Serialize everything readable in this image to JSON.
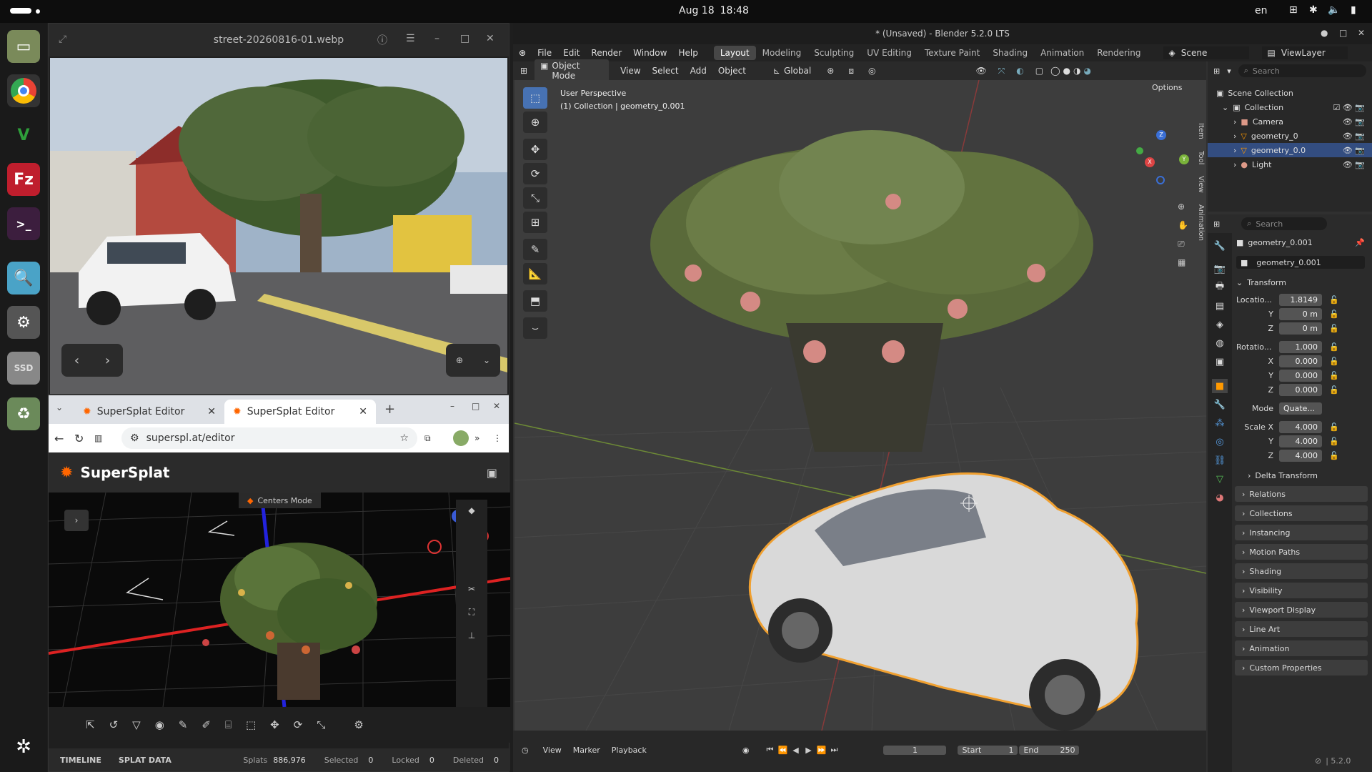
{
  "topbar": {
    "date": "Aug 18",
    "time": "18:48",
    "lang": "en"
  },
  "dock": {
    "ssd_label": "SSD"
  },
  "viewer": {
    "title": "street-20260816-01.webp"
  },
  "chrome": {
    "tabs": [
      {
        "label": "SuperSplat Editor"
      },
      {
        "label": "SuperSplat Editor"
      }
    ],
    "url": "superspl.at/editor"
  },
  "supersplat": {
    "title": "SuperSplat",
    "mode_badge": "Centers Mode",
    "status": {
      "tab1": "TIMELINE",
      "tab2": "SPLAT DATA",
      "splats_label": "Splats",
      "splats": "886,976",
      "selected_label": "Selected",
      "selected": "0",
      "locked_label": "Locked",
      "locked": "0",
      "deleted_label": "Deleted",
      "deleted": "0"
    }
  },
  "blender": {
    "title": "* (Unsaved) - Blender 5.2.0 LTS",
    "menus": [
      "File",
      "Edit",
      "Render",
      "Window",
      "Help"
    ],
    "workspaces": [
      "Layout",
      "Modeling",
      "Sculpting",
      "UV Editing",
      "Texture Paint",
      "Shading",
      "Animation",
      "Rendering"
    ],
    "scene": "Scene",
    "viewlayer": "ViewLayer",
    "header": {
      "mode": "Object Mode",
      "view": "View",
      "select": "Select",
      "add": "Add",
      "object": "Object",
      "orient": "Global",
      "options": "Options"
    },
    "overlay": {
      "line1": "User Perspective",
      "line2": "(1) Collection | geometry_0.001"
    },
    "side_tabs": [
      "Item",
      "Tool",
      "View",
      "Animation"
    ],
    "outliner": {
      "search": "Search",
      "scene_collection": "Scene Collection",
      "collection": "Collection",
      "items": [
        "Camera",
        "geometry_0",
        "geometry_0.0",
        "Light"
      ]
    },
    "props": {
      "search": "Search",
      "object_name": "geometry_0.001",
      "data_name": "geometry_0.001",
      "transform": "Transform",
      "loc_label": "Locatio...",
      "loc_x": "1.8149",
      "loc_y": "0 m",
      "loc_z": "0 m",
      "rot_label": "Rotatio...",
      "rot_w": "1.000",
      "rot_x": "0.000",
      "rot_y": "0.000",
      "rot_z": "0.000",
      "mode_label": "Mode",
      "mode": "Quate...",
      "scale_label": "Scale X",
      "scale_x": "4.000",
      "scale_y": "4.000",
      "scale_z": "4.000",
      "delta": "Delta Transform",
      "panels": [
        "Relations",
        "Collections",
        "Instancing",
        "Motion Paths",
        "Shading",
        "Visibility",
        "Viewport Display",
        "Line Art",
        "Animation",
        "Custom Properties"
      ]
    },
    "timeline": {
      "view": "View",
      "marker": "Marker",
      "playback": "Playback",
      "frame": "1",
      "start_label": "Start",
      "start": "1",
      "end_label": "End",
      "end": "250"
    },
    "version": "5.2.0"
  }
}
